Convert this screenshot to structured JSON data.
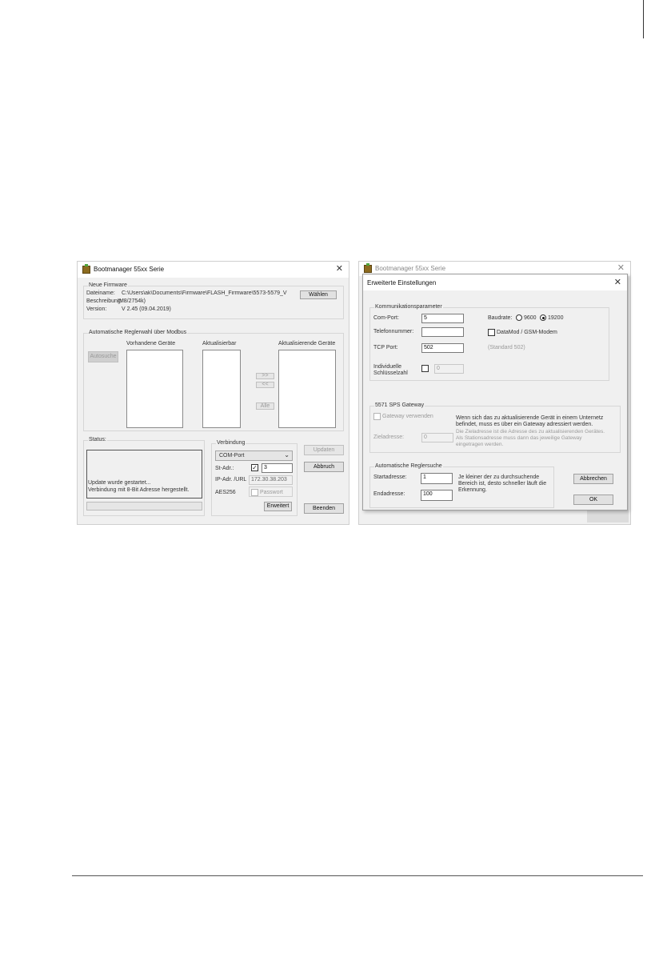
{
  "window1": {
    "title": "Bootmanager 55xx Serie",
    "firmware": {
      "group_title": "Neue Firmware",
      "filename_label": "Dateiname:",
      "filename_value": "C:\\Users\\ak\\Documents\\Firmware\\FLASH_Firmware\\5573-5579_V",
      "description_label": "Beschreibung:",
      "description_value": "IM8/2754k)",
      "version_label": "Version:",
      "version_value": "V 2.45 (09.04.2019)",
      "choose_button": "Wählen"
    },
    "autoselect": {
      "group_title": "Automatische Reglerwahl über Modbus",
      "autosearch_button": "Autosuche",
      "existing_label": "Vorhandene Geräte",
      "updatable_label": "Aktualisierbar",
      "updating_label": "Aktualisierende Geräte",
      "move_right": ">>",
      "move_left": "<<",
      "all_button": "Alle"
    },
    "status": {
      "group_title": "Status:",
      "line1": "Update wurde gestartet...",
      "line2": "Verbindung mit 8-Bit Adresse hergestellt."
    },
    "connection": {
      "group_title": "Verbindung",
      "port_select": "COM-Port",
      "st_adr_label": "St-Adr.:",
      "st_adr_value": "3",
      "ip_label": "IP-Adr. /URL",
      "ip_value": "172.30.38.203",
      "aes_label": "AES256",
      "password_label": "Passwort",
      "extended_button": "Erweitert"
    },
    "buttons": {
      "update": "Updaten",
      "abort": "Abbruch",
      "quit": "Beenden"
    }
  },
  "window2": {
    "title": "Bootmanager 55xx Serie",
    "dialog_title": "Erweiterte Einstellungen",
    "comm": {
      "group_title": "Kommunikationsparameter",
      "com_port_label": "Com-Port:",
      "com_port_value": "5",
      "phone_label": "Telefonnummer:",
      "phone_value": "",
      "tcp_label": "TCP Port:",
      "tcp_value": "502",
      "key_label_1": "Individuelle",
      "key_label_2": "Schlüsselzahl",
      "key_value": "0",
      "baud_label": "Baudrate:",
      "baud_9600": "9600",
      "baud_19200": "19200",
      "datamod_label": "DataMod / GSM-Modem",
      "standard_note": "(Standard 502)"
    },
    "gateway": {
      "group_title": "5571 SPS Gateway",
      "use_label": "Gateway verwenden",
      "info_1": "Wenn sich das zu aktualisierende Gerät in einem Unternetz",
      "info_2": "befindet, muss es über ein Gateway adressiert werden.",
      "info_3": "Die Zieladresse ist die Adresse des zu aktualisierenden Gerätes.",
      "info_4": "Als Stationsadresse muss dann das jeweilige Gateway",
      "info_5": "eingetragen werden.",
      "target_label": "Zieladresse:",
      "target_value": "0"
    },
    "search": {
      "group_title": "Automatische Reglersuche",
      "start_label": "Startadresse:",
      "start_value": "1",
      "end_label": "Endadresse:",
      "end_value": "100",
      "info_1": "Je kleiner der zu durchsuchende",
      "info_2": "Bereich ist, desto schneller läuft die",
      "info_3": "Erkennung."
    },
    "buttons": {
      "cancel": "Abbrechen",
      "ok": "OK"
    }
  }
}
